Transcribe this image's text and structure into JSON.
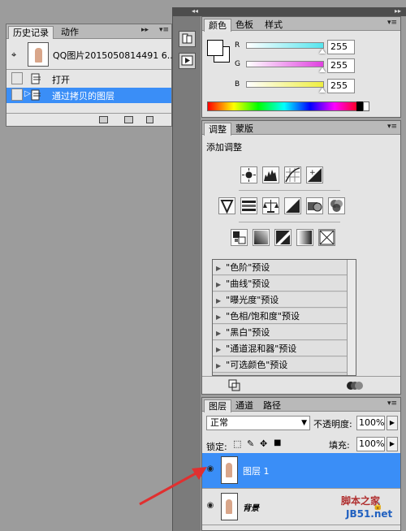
{
  "history": {
    "tabs": [
      "历史记录",
      "动作"
    ],
    "snapshot": "QQ图片2015050814491 6....",
    "items": [
      "打开",
      "通过拷贝的图层"
    ]
  },
  "color": {
    "tabs": [
      "颜色",
      "色板",
      "样式"
    ],
    "channels": [
      {
        "name": "R",
        "value": "255",
        "gradient": "#55e5ee"
      },
      {
        "name": "G",
        "value": "255",
        "gradient": "#e040e0"
      },
      {
        "name": "B",
        "value": "255",
        "gradient": "#eeee40"
      }
    ]
  },
  "adjust": {
    "tabs": [
      "调整",
      "蒙版"
    ],
    "title": "添加调整",
    "presets": [
      "\"色阶\"预设",
      "\"曲线\"预设",
      "\"曝光度\"预设",
      "\"色相/饱和度\"预设",
      "\"黑白\"预设",
      "\"通道混和器\"预设",
      "\"可选颜色\"预设"
    ]
  },
  "layers": {
    "tabs": [
      "图层",
      "通道",
      "路径"
    ],
    "blend_mode": "正常",
    "opacity_label": "不透明度:",
    "opacity": "100%",
    "lock_label": "锁定:",
    "fill_label": "填充:",
    "fill": "100%",
    "items": [
      {
        "name": "图层 1",
        "selected": true
      },
      {
        "name": "背景",
        "selected": false
      }
    ]
  },
  "watermark": {
    "line1": "脚本之家",
    "line2": "JB51.net"
  },
  "colors": {
    "selection": "#3a8ef7",
    "arrow": "#e03030"
  }
}
